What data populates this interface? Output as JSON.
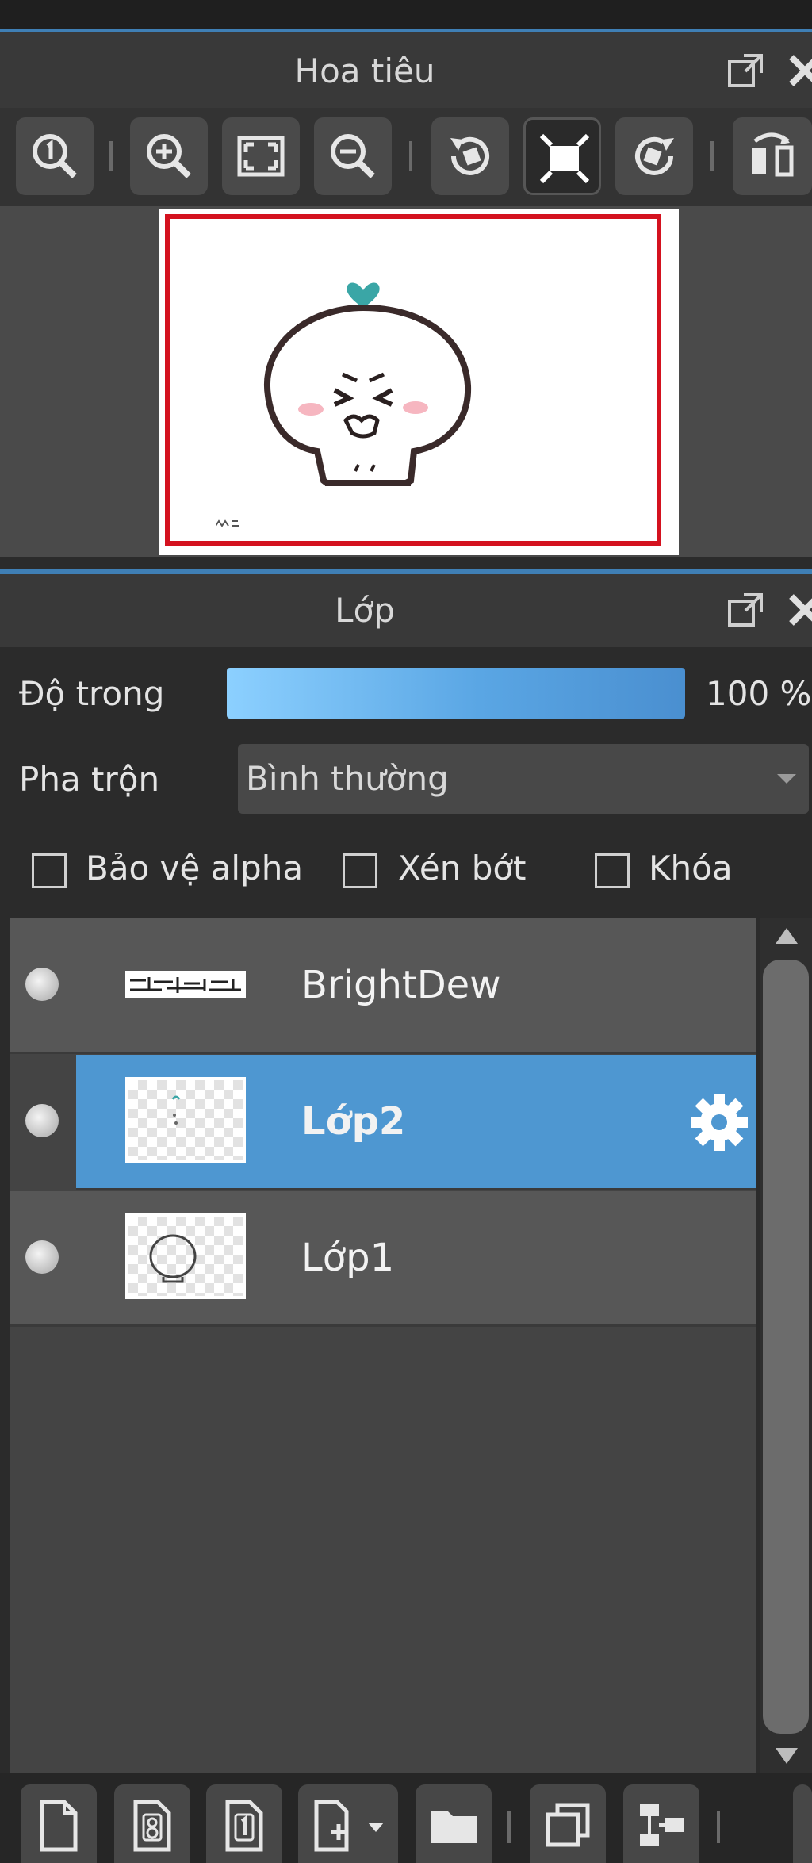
{
  "navigator": {
    "title": "Hoa tiêu",
    "toolbar": [
      {
        "name": "zoom-actual-size",
        "icon": "zoom-one-icon"
      },
      {
        "name": "zoom-in",
        "icon": "zoom-in-icon"
      },
      {
        "name": "fit-to-window",
        "icon": "fit-screen-icon"
      },
      {
        "name": "zoom-out",
        "icon": "zoom-out-icon"
      },
      {
        "name": "rotate-left",
        "icon": "rotate-left-icon"
      },
      {
        "name": "fullscreen",
        "icon": "fullscreen-icon",
        "active": true
      },
      {
        "name": "rotate-right",
        "icon": "rotate-right-icon"
      },
      {
        "name": "flip-horizontal",
        "icon": "flip-horizontal-icon"
      }
    ],
    "preview_signature": "MDS"
  },
  "layers_panel": {
    "title": "Lớp",
    "opacity_label": "Độ trong",
    "opacity_value": "100 %",
    "opacity_fraction": 1.0,
    "blend_label": "Pha trộn",
    "blend_value": "Bình thường",
    "checkboxes": {
      "protect_alpha": "Bảo vệ alpha",
      "clipping": "Xén bớt",
      "lock": "Khóa"
    },
    "layers": [
      {
        "name": "BrightDew",
        "selected": false
      },
      {
        "name": "Lớp2",
        "selected": true
      },
      {
        "name": "Lớp1",
        "selected": false
      }
    ]
  },
  "bottom_toolbar": [
    {
      "name": "new-layer",
      "icon": "new-page-icon"
    },
    {
      "name": "new-8bit-layer",
      "icon": "page-8-icon"
    },
    {
      "name": "new-1bit-layer",
      "icon": "page-1-icon"
    },
    {
      "name": "add-layer-menu",
      "icon": "add-page-dropdown-icon"
    },
    {
      "name": "new-folder",
      "icon": "folder-icon"
    },
    {
      "name": "duplicate-layer",
      "icon": "duplicate-icon"
    },
    {
      "name": "merge-layers",
      "icon": "merge-icon"
    }
  ],
  "colors": {
    "accent": "#4e97d1",
    "frame_red": "#d4121f",
    "heart_teal": "#3aa6a6"
  }
}
